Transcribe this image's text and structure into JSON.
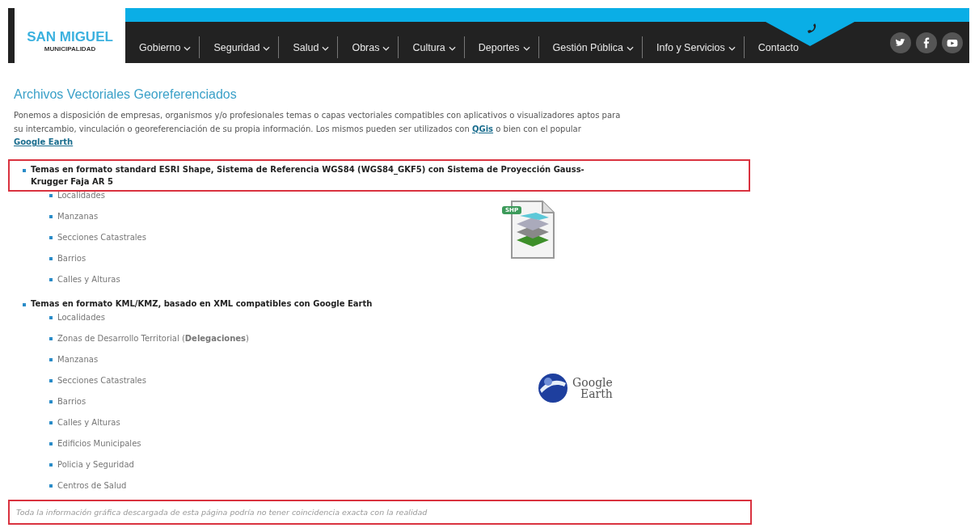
{
  "logo": {
    "title": "SAN MIGUEL",
    "subtitle": "MUNICIPALIDAD"
  },
  "nav": [
    {
      "label": "Gobierno",
      "dropdown": true
    },
    {
      "label": "Seguridad",
      "dropdown": true
    },
    {
      "label": "Salud",
      "dropdown": true
    },
    {
      "label": "Obras",
      "dropdown": true
    },
    {
      "label": "Cultura",
      "dropdown": true
    },
    {
      "label": "Deportes",
      "dropdown": true
    },
    {
      "label": "Gestión Pública",
      "dropdown": true
    },
    {
      "label": "Info y Servicios",
      "dropdown": true
    },
    {
      "label": "Contacto",
      "dropdown": false
    }
  ],
  "social": [
    {
      "kind": "twitter"
    },
    {
      "kind": "facebook"
    },
    {
      "kind": "youtube"
    }
  ],
  "heading": "Archivos Vectoriales Georeferenciados",
  "intro": [
    {
      "kind": "text",
      "text": "Ponemos a disposición de empresas, organismos y/o profesionales temas o capas vectoriales compatibles con aplicativos o visualizadores aptos para su intercambio, vinculación o georeferenciación de su propia información. Los mismos pueden ser utilizados con "
    },
    {
      "kind": "link",
      "text": "QGis"
    },
    {
      "kind": "text",
      "text": " o bien con el popular "
    },
    {
      "kind": "link",
      "text": "Google Earth"
    }
  ],
  "topics": [
    {
      "label": "Temas en formato standard ESRI Shape, Sistema de Referencia WGS84 (WGS84_GKF5) con Sistema de Proyección Gauss-Krugger Faja AR 5",
      "highlighted": true,
      "icon": {
        "kind": "shp",
        "label": "SHP"
      },
      "children": [
        "Localidades",
        "Manzanas",
        "Secciones Catastrales",
        "Barrios",
        "Calles y Alturas"
      ]
    },
    {
      "label": "Temas en formato KML/KMZ, basado en XML compatibles con Google Earth",
      "highlighted": false,
      "icon": {
        "kind": "google_earth",
        "line_1": "Google",
        "line_2": "Earth"
      },
      "children": [
        "Localidades",
        "Zonas de Desarrollo Territorial (**Delegaciones**)",
        "Manzanas",
        "Secciones Catastrales",
        "Barrios",
        "Calles y Alturas",
        "Edificios Municipales",
        "Policia y Seguridad",
        "Centros de Salud"
      ]
    }
  ],
  "disclaimer": {
    "text": "Toda la información gráfica descargada de esta página podría no tener coincidencia exacta con la realidad",
    "highlighted": true
  }
}
